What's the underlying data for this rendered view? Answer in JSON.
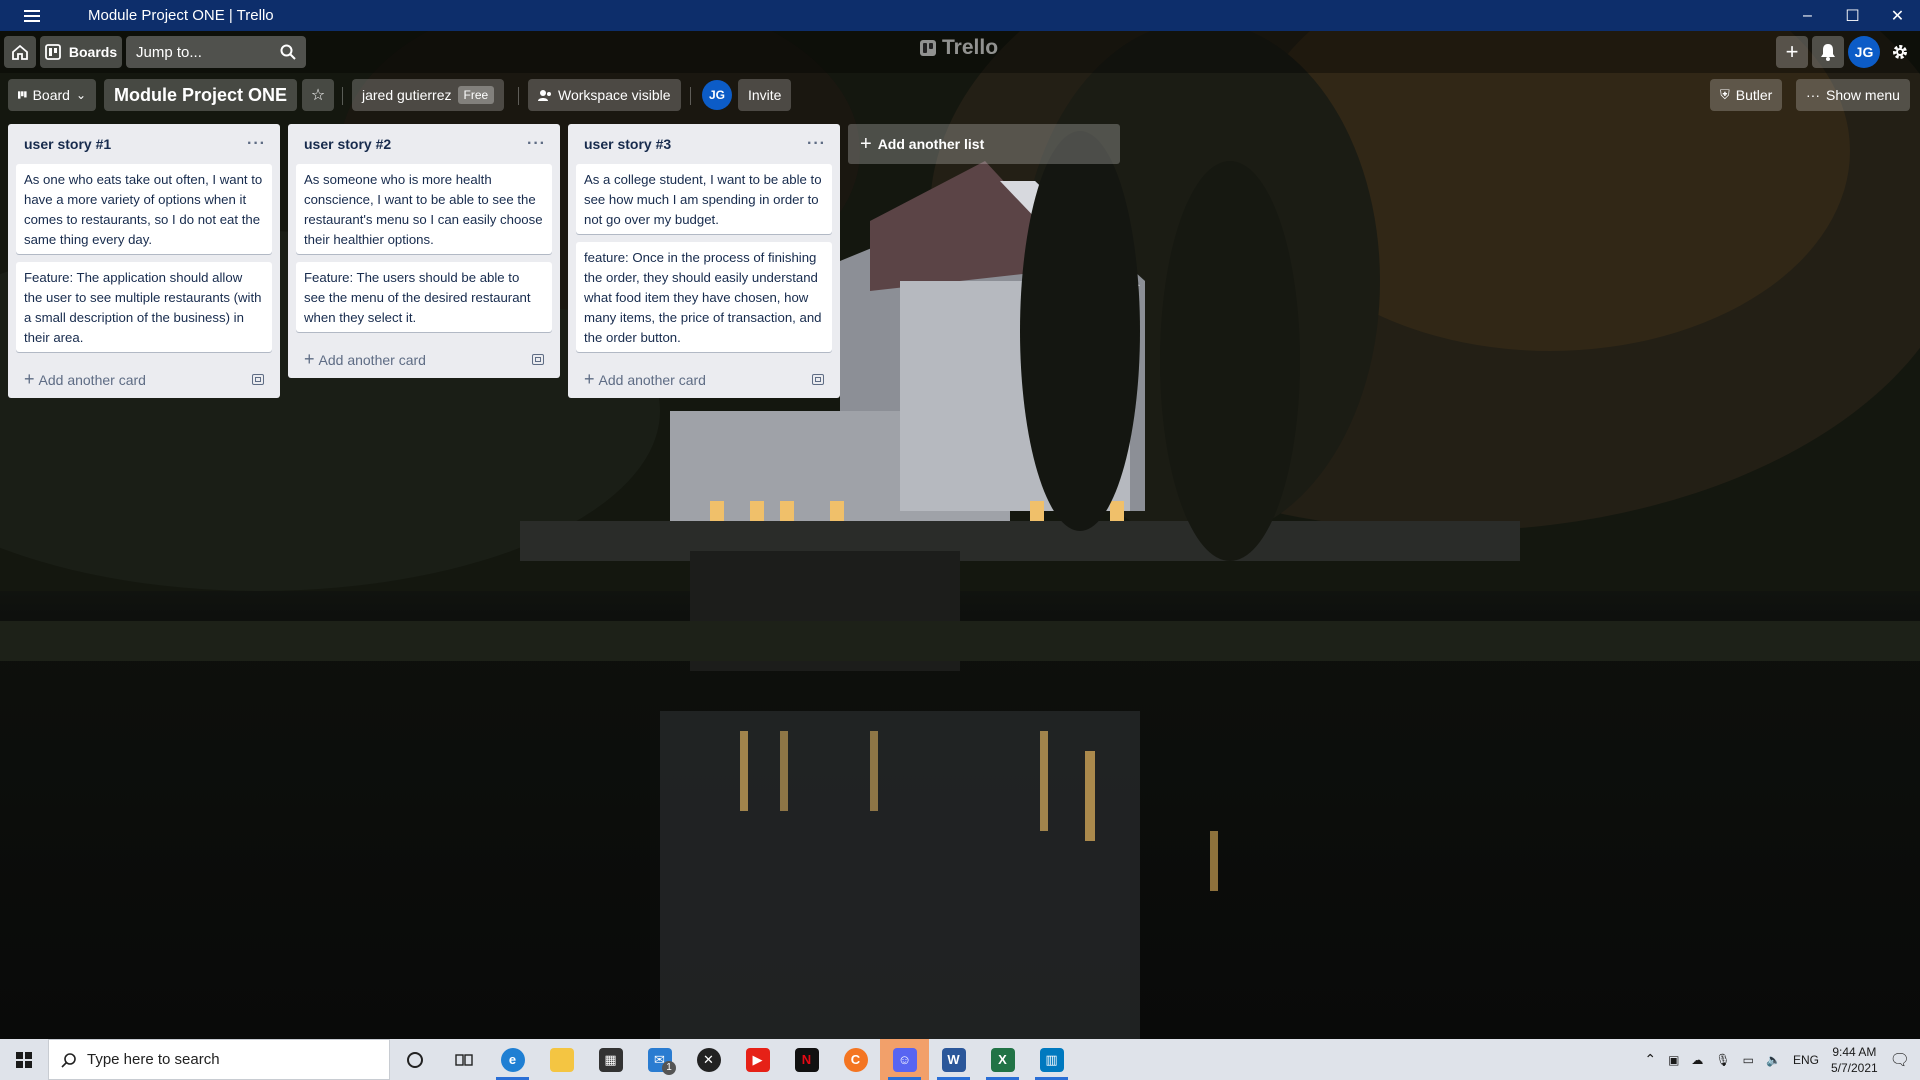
{
  "window": {
    "title": "Module Project ONE | Trello",
    "minimize_label": "–",
    "maximize_label": "☐",
    "close_label": "✕"
  },
  "header": {
    "boards_label": "Boards",
    "search_placeholder": "Jump to...",
    "logo_text": "Trello",
    "avatar_initials": "JG"
  },
  "board_header": {
    "view_label": "Board",
    "board_name": "Module Project ONE",
    "workspace_name": "jared gutierrez",
    "workspace_badge": "Free",
    "visibility_label": "Workspace visible",
    "member_initials": "JG",
    "invite_label": "Invite",
    "butler_label": "Butler",
    "show_menu_label": "Show menu"
  },
  "lists": [
    {
      "title": "user story #1",
      "cards": [
        "As one who eats take out often, I want to have a more variety of options when it comes to restaurants, so I do not eat the same thing every day.",
        "Feature: The application should allow the user to see multiple restaurants (with a small description of the business) in their area."
      ],
      "add_card_label": "Add another card"
    },
    {
      "title": "user story #2",
      "cards": [
        "As someone who is more health conscience, I want to be able to see the restaurant's menu so I can easily choose their healthier options.",
        "Feature: The users should be able to see the menu of the desired restaurant when they select it."
      ],
      "add_card_label": "Add another card"
    },
    {
      "title": "user story #3",
      "cards": [
        "As a college student, I want to be able to see how much I am spending in order to not go over my budget.",
        "feature: Once in the process of finishing the order, they should easily understand what food item they have chosen, how many items, the price of transaction, and the order button."
      ],
      "add_card_label": "Add another card"
    }
  ],
  "add_list_label": "Add another list",
  "taskbar": {
    "search_placeholder": "Type here to search",
    "mail_badge": "1",
    "language": "ENG",
    "time": "9:44 AM",
    "date": "5/7/2021"
  }
}
